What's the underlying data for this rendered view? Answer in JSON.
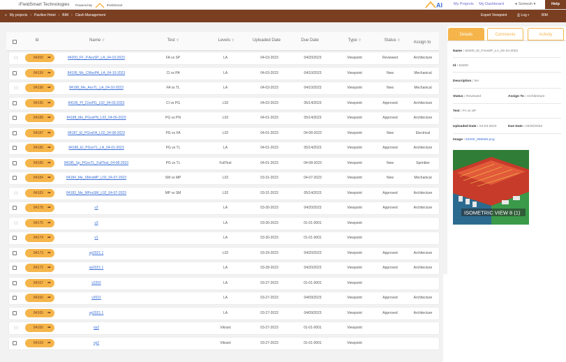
{
  "app": {
    "brand": "iFieldSmart Technologies",
    "powered_by": "Powered By",
    "powered_brand": "iFieldSmart",
    "nav": [
      "My Projects",
      "My Dashboard"
    ],
    "user": "Somesh",
    "help": "Help"
  },
  "breadcrumb": {
    "items": [
      "My projects",
      "Pavilion Hotel",
      "BIM",
      "Clash Management"
    ],
    "export": "Export Viewpoint",
    "log": "Log",
    "bim": "BIM"
  },
  "table": {
    "headers": [
      "Id",
      "Name",
      "Test",
      "Levels",
      "Uploaded Date",
      "Due Date",
      "Type",
      "Status",
      "Assign to"
    ],
    "rows": [
      {
        "id": "84200",
        "name": "84200_FF_P.AvsSP_LA_04-10-2023",
        "test": "FA vs SP",
        "level": "LA",
        "uploaded": "04-03-2023",
        "due": "04/20/2023",
        "type": "Viewpoint",
        "status": "Reviewed",
        "assign": "Architecture",
        "mark": "drag"
      },
      {
        "id": "84199",
        "name": "84199_Mc_CMxsPA_LA_04-10-2023",
        "test": "CI vs PA",
        "level": "LA",
        "uploaded": "04-03-2023",
        "due": "04/10/2023",
        "type": "Viewpoint",
        "status": "New",
        "assign": "Mechanical",
        "mark": "check"
      },
      {
        "id": "84198",
        "name": "84198_Me_AvsTL_LA_04-10-2023",
        "test": "FA vs TL",
        "level": "LA",
        "uploaded": "04-03-2023",
        "due": "04/10/2023",
        "type": "Viewpoint",
        "status": "New",
        "assign": "Mechanical",
        "mark": "drag"
      },
      {
        "id": "84195",
        "name": "84195_Pl_CIvsPG_L02_04-03-2023",
        "test": "CI vs PG",
        "level": "L02",
        "uploaded": "04-02-2023",
        "due": "05/14/2023",
        "type": "Viewpoint",
        "status": "Approved",
        "assign": "Architecture",
        "mark": "check"
      },
      {
        "id": "84188",
        "name": "84188_Me_PGvsPN_L02_04-06-2023",
        "test": "PG vs PN",
        "level": "L02",
        "uploaded": "04-01-2023",
        "due": "05/14/2023",
        "type": "Viewpoint",
        "status": "Approved",
        "assign": "Architecture",
        "mark": "check"
      },
      {
        "id": "84187",
        "name": "84187_El_PGvsFA_L02_04-08-2023",
        "test": "PG vs FA",
        "level": "L02",
        "uploaded": "04-01-2023",
        "due": "04-08-2023",
        "type": "Viewpoint",
        "status": "New",
        "assign": "Electrical",
        "mark": "check"
      },
      {
        "id": "84186",
        "name": "84186_El_PGvsTL_LA_04-01-2023",
        "test": "PG vs TL",
        "level": "LA",
        "uploaded": "04-01-2023",
        "due": "05/14/2023",
        "type": "Viewpoint",
        "status": "Approved",
        "assign": "Architecture",
        "mark": "check"
      },
      {
        "id": "84185",
        "name": "84185_Sp_PGvsTL_FullTest_04-08-2023",
        "test": "PG vs TL",
        "level": "FullTest",
        "uploaded": "04-01-2023",
        "due": "04-08-2023",
        "type": "Viewpoint",
        "status": "New",
        "assign": "Sprinkler",
        "mark": "check"
      },
      {
        "id": "84184",
        "name": "84184_Me_SMvsMP_L02_04-07-2023",
        "test": "SM vs MP",
        "level": "L02",
        "uploaded": "03-31-2023",
        "due": "04-07-2023",
        "type": "Viewpoint",
        "status": "New",
        "assign": "Mechanical",
        "mark": "check"
      },
      {
        "id": "84183",
        "name": "84183_Me_MPvsSM_L02_04-07-2023",
        "test": "MP vs SM",
        "level": "L02",
        "uploaded": "03-31-2023",
        "due": "05/14/2023",
        "type": "Viewpoint",
        "status": "Approved",
        "assign": "Architecture",
        "mark": "drag"
      },
      {
        "id": "84178",
        "name": "v2",
        "test": "",
        "level": "LA",
        "uploaded": "03-30-2023",
        "due": "04/20/2023",
        "type": "Viewpoint",
        "status": "Approved",
        "assign": "Architecture",
        "mark": "check"
      },
      {
        "id": "84175",
        "name": "v3",
        "test": "",
        "level": "LA",
        "uploaded": "03-30-2023",
        "due": "01-01-0001",
        "type": "Viewpoint",
        "status": "",
        "assign": "",
        "mark": "drag"
      },
      {
        "id": "84174",
        "name": "v1",
        "test": "",
        "level": "LA",
        "uploaded": "03-30-2023",
        "due": "01-01-0001",
        "type": "Viewpoint",
        "status": "",
        "assign": "",
        "mark": "check"
      },
      {
        "id": "84173",
        "name": "vp2021.1",
        "test": "",
        "level": "L02",
        "uploaded": "03-29-2023",
        "due": "04/20/2023",
        "type": "Viewpoint",
        "status": "Approved",
        "assign": "Architecture",
        "mark": "check"
      },
      {
        "id": "84172",
        "name": "vp2021.1",
        "test": "",
        "level": "LA",
        "uploaded": "03-28-2023",
        "due": "04/20/2023",
        "type": "Viewpoint",
        "status": "Approved",
        "assign": "Architecture",
        "mark": "check"
      },
      {
        "id": "84167",
        "name": "v2202",
        "test": "",
        "level": "LA",
        "uploaded": "03-27-2023",
        "due": "01-01-0001",
        "type": "Viewpoint",
        "status": "",
        "assign": "",
        "mark": "check"
      },
      {
        "id": "84166",
        "name": "v2021",
        "test": "",
        "level": "LA",
        "uploaded": "03-27-2023",
        "due": "04/09/2023",
        "type": "Viewpoint",
        "status": "Approved",
        "assign": "Architecture",
        "mark": "check"
      },
      {
        "id": "84165",
        "name": "vp2021.1",
        "test": "",
        "level": "LA",
        "uploaded": "03-27-2023",
        "due": "04/09/2023",
        "type": "Viewpoint",
        "status": "Approved",
        "assign": "Architecture",
        "mark": "check"
      },
      {
        "id": "84160",
        "name": "vp2",
        "test": "",
        "level": "Vikrant",
        "uploaded": "03-27-2023",
        "due": "01-01-0001",
        "type": "Viewpoint",
        "status": "",
        "assign": "",
        "mark": "drag"
      },
      {
        "id": "84159",
        "name": "vp2",
        "test": "",
        "level": "Vikrant",
        "uploaded": "03-27-2023",
        "due": "01-01-0001",
        "type": "Viewpoint",
        "status": "",
        "assign": "",
        "mark": "check"
      }
    ]
  },
  "panel": {
    "tabs": [
      "Details",
      "Comments",
      "Activity"
    ],
    "name_label": "Name :",
    "name_value": "84200_El_FAvsSP_LA_04-10-2023",
    "id_label": "Id :",
    "id_value": "84200",
    "desc_label": "Description :",
    "desc_value": "NA",
    "status_label": "Status :",
    "status_value": "Reviewed",
    "assign_label": "Assign To :",
    "assign_value": "Architecture",
    "test_label": "Test :",
    "test_value": "FA vs SP",
    "uploaded_label": "Uploaded Date :",
    "uploaded_value": "04-03-2023",
    "due_label": "Due Date :",
    "due_value": "04/20/2023",
    "image_label": "Image :",
    "image_value": "84200_955565.png",
    "thumb_caption": "ISOMETRIC VIEW 8 (1)"
  },
  "colors": {
    "brand": "#7a3e21",
    "accent": "#f5b54a",
    "link": "#3b6fd6"
  }
}
